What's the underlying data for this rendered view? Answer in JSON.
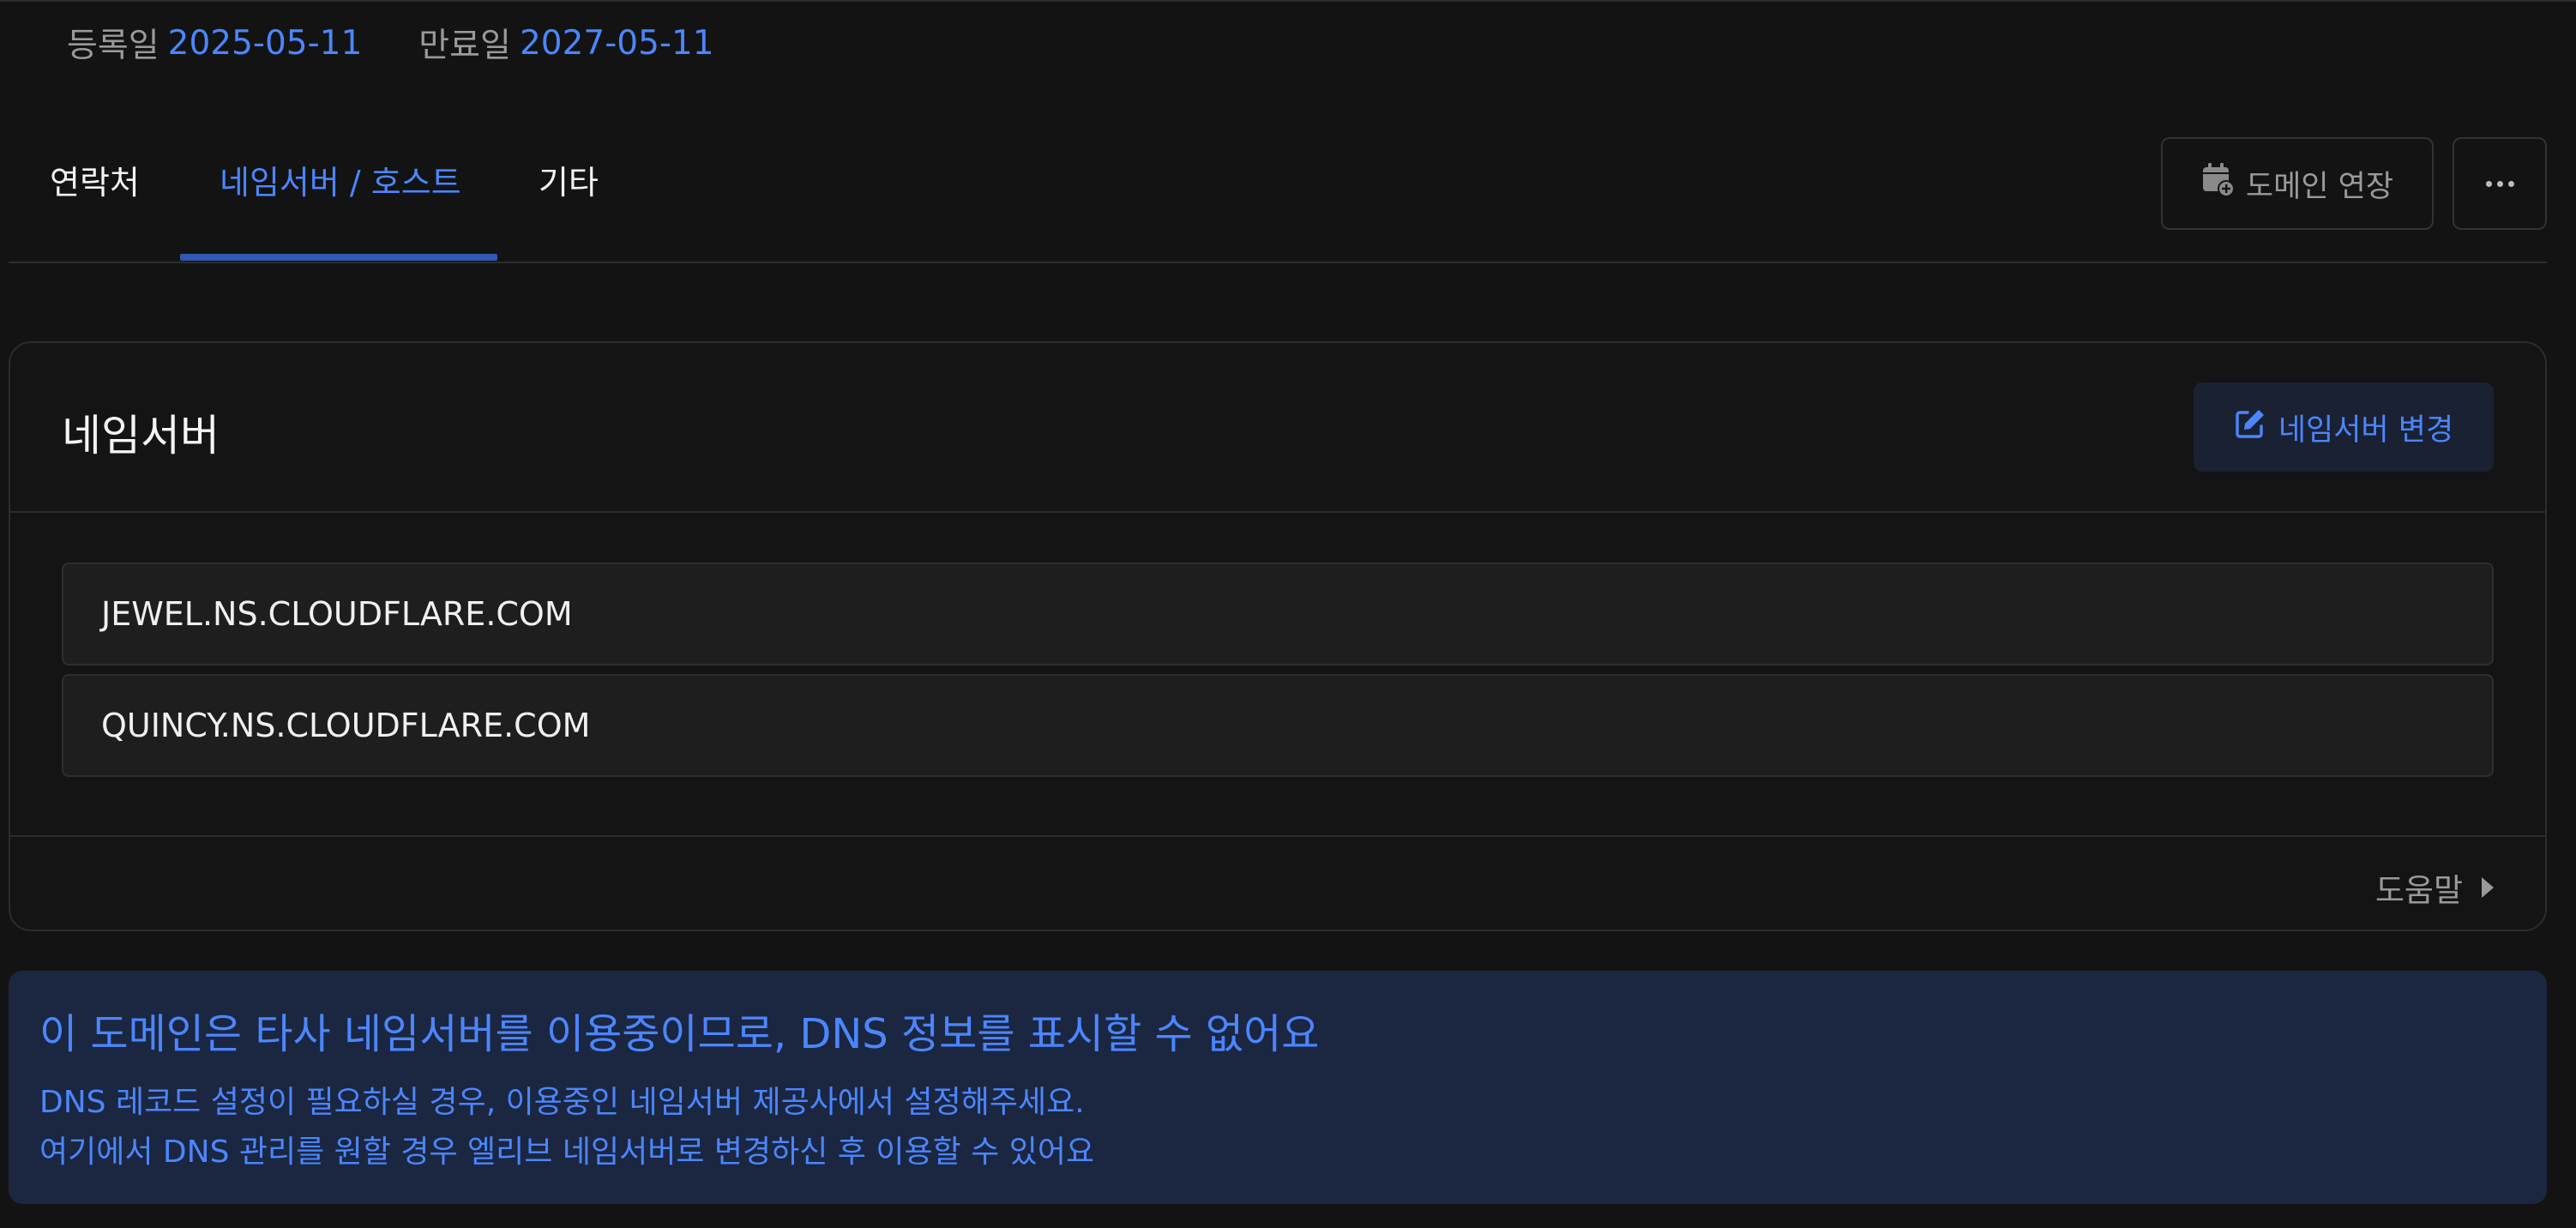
{
  "dates": {
    "registered_label": "등록일",
    "registered_value": "2025-05-11",
    "expiry_label": "만료일",
    "expiry_value": "2027-05-11"
  },
  "tabs": [
    {
      "label": "연락처",
      "active": false
    },
    {
      "label": "네임서버 / 호스트",
      "active": true
    },
    {
      "label": "기타",
      "active": false
    }
  ],
  "actions": {
    "renew_label": "도메인 연장",
    "more_icon": "more-horizontal-icon"
  },
  "nameserver_card": {
    "title": "네임서버",
    "change_button_label": "네임서버 변경",
    "nameservers": [
      "JEWEL.NS.CLOUDFLARE.COM",
      "QUINCY.NS.CLOUDFLARE.COM"
    ],
    "help_label": "도움말"
  },
  "notice": {
    "title": "이 도메인은 타사 네임서버를 이용중이므로, DNS 정보를 표시할 수 없어요",
    "line1": "DNS 레코드 설정이 필요하실 경우, 이용중인 네임서버 제공사에서 설정해주세요.",
    "line2": "여기에서 DNS 관리를 원할 경우 엘리브 네임서버로 변경하신 후 이용할 수 있어요"
  },
  "colors": {
    "background": "#131313",
    "accent": "#4b86ff",
    "notice_bg": "#1b2640",
    "muted": "#9a9a9a"
  }
}
